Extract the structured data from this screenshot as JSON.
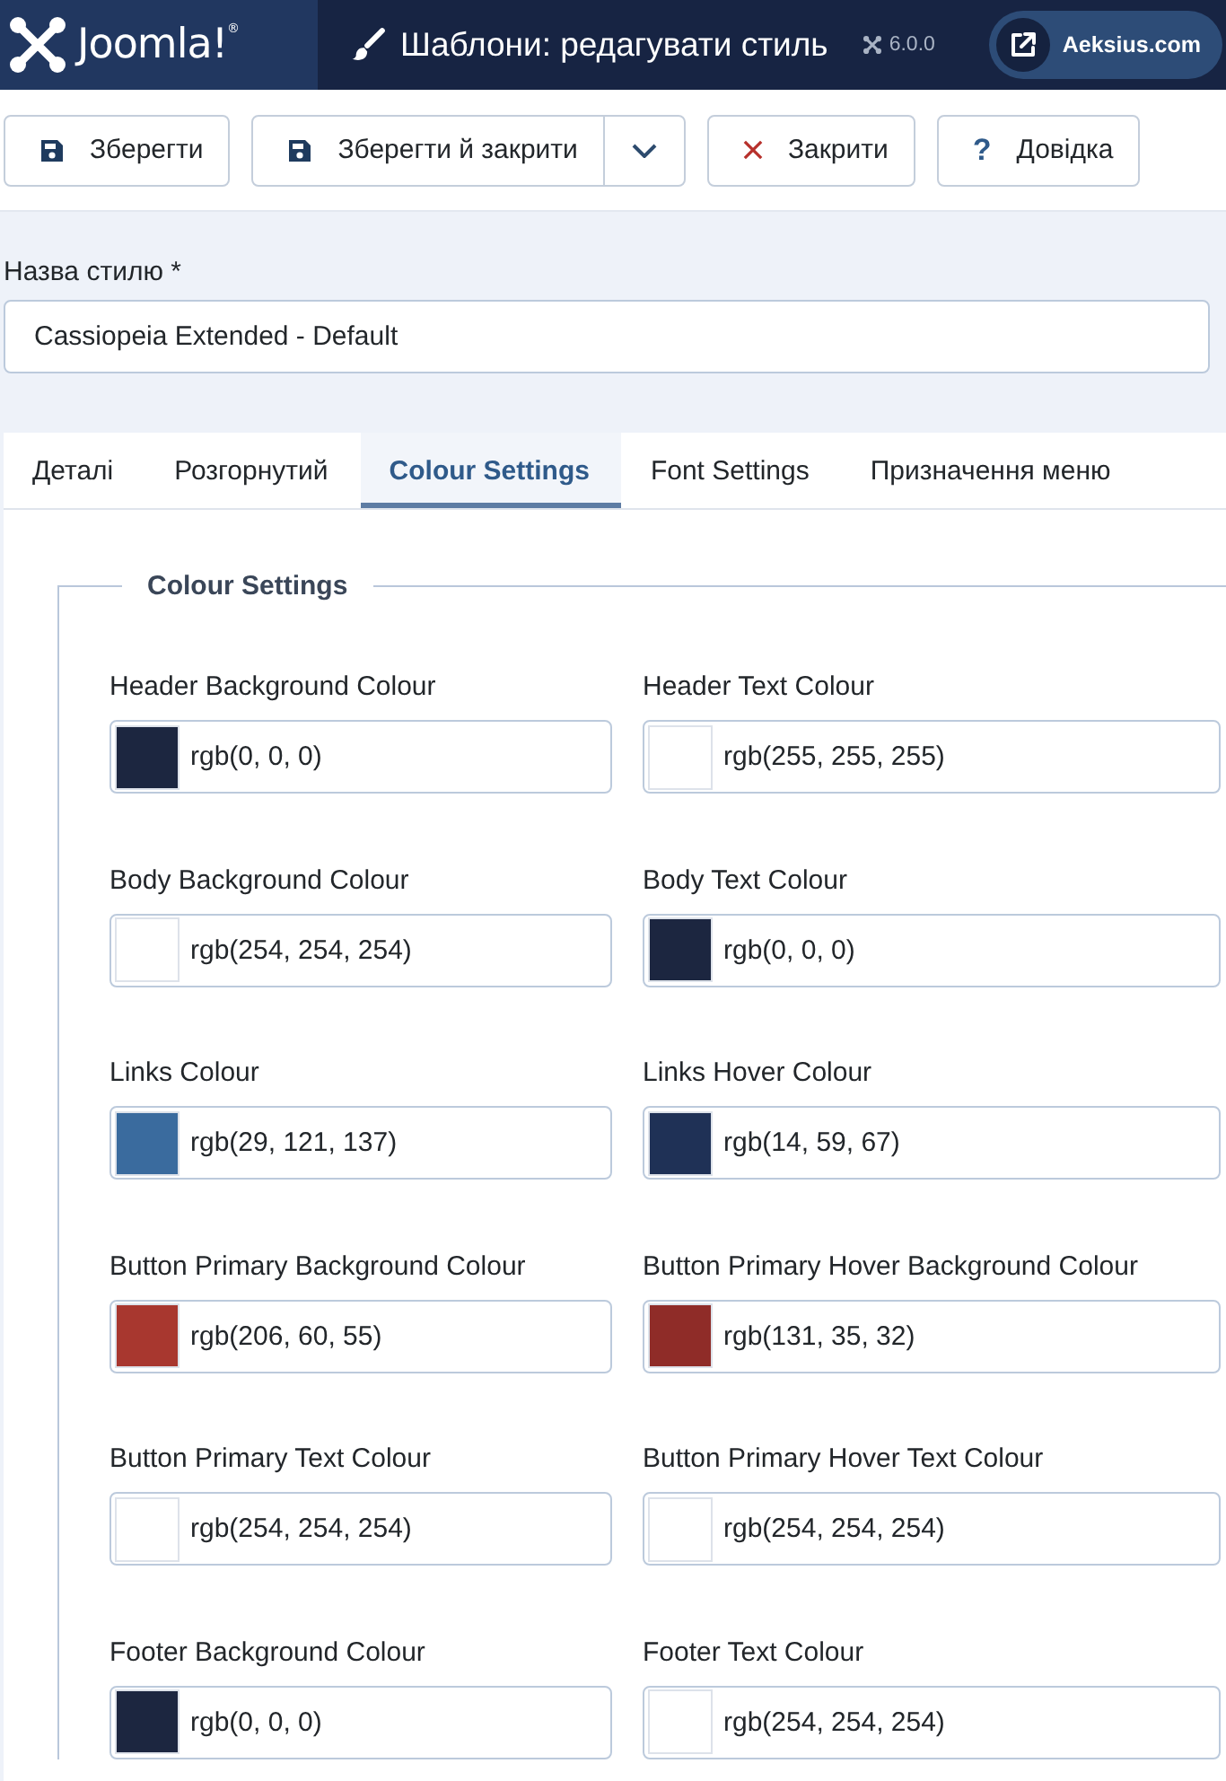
{
  "header": {
    "logo": "Joomla!$^{®}$",
    "title": "Шаблони: редагувати стиль",
    "version": "6.0.0",
    "site_link": "Aeksius.com"
  },
  "toolbar": {
    "buttons": [
      {
        "kind": "save",
        "label": "Зберегти"
      },
      {
        "kind": "save-split",
        "label": "Зберегти й закрити"
      },
      {
        "kind": "close",
        "label": "Закрити"
      },
      {
        "kind": "help",
        "label": "Довідка",
        "icon": "?"
      }
    ]
  },
  "style_name": {
    "label": "Назва стилю *",
    "value": "Cassiopeia Extended - Default"
  },
  "tabs": [
    {
      "label": "Деталі",
      "selected": false
    },
    {
      "label": "Розгорнутий",
      "selected": false
    },
    {
      "label": "Colour Settings",
      "selected": true
    },
    {
      "label": "Font Settings",
      "selected": false
    },
    {
      "label": "Призначення меню",
      "selected": false
    }
  ],
  "fieldset": {
    "legend": "Colour Settings",
    "fields": [
      {
        "label": "Header Background Colour",
        "value": "rgb(0, 0, 0)",
        "color": "#1c2640"
      },
      {
        "label": "Header Text Colour",
        "value": "rgb(255, 255, 255)",
        "color": "#ffffff"
      },
      {
        "label": "Body Background Colour",
        "value": "rgb(254, 254, 254)",
        "color": "#ffffff"
      },
      {
        "label": "Body Text Colour",
        "value": "rgb(0, 0, 0)",
        "color": "#1c2640"
      },
      {
        "label": "Links Colour",
        "value": "rgb(29, 121, 137)",
        "color": "#3a6b9e"
      },
      {
        "label": "Links Hover Colour",
        "value": "rgb(14, 59, 67)",
        "color": "#1f3156"
      },
      {
        "label": "Button Primary Background Colour",
        "value": "rgb(206, 60, 55)",
        "color": "#a8372f"
      },
      {
        "label": "Button Primary Hover Background Colour",
        "value": "rgb(131, 35, 32)",
        "color": "#8f2c28"
      },
      {
        "label": "Button Primary Text Colour",
        "value": "rgb(254, 254, 254)",
        "color": "#ffffff"
      },
      {
        "label": "Button Primary Hover Text Colour",
        "value": "rgb(254, 254, 254)",
        "color": "#ffffff"
      },
      {
        "label": "Footer Background Colour",
        "value": "rgb(0, 0, 0)",
        "color": "#1c2640"
      },
      {
        "label": "Footer Text Colour",
        "value": "rgb(254, 254, 254)",
        "color": "#ffffff"
      }
    ]
  }
}
